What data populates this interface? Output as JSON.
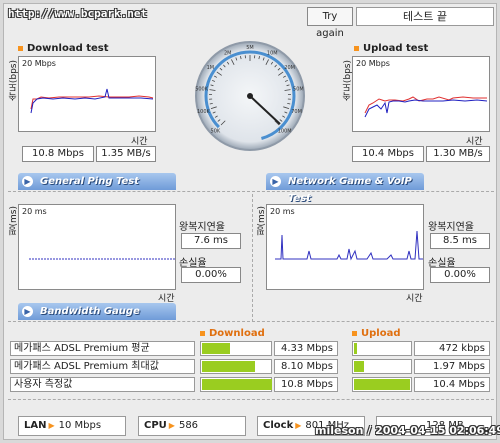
{
  "header": {
    "url": "http://www.bcpark.net",
    "try_again": "Try again",
    "test_end": "테스트 끝"
  },
  "download": {
    "title": "Download test",
    "scale": "20 Mbps",
    "ylabel": "속도(bps)",
    "xlabel": "시간",
    "mbps": "10.8 Mbps",
    "mbs": "1.35 MB/s"
  },
  "upload": {
    "title": "Upload test",
    "scale": "20 Mbps",
    "ylabel": "속도(bps)",
    "xlabel": "시간",
    "mbps": "10.4 Mbps",
    "mbs": "1.30 MB/s"
  },
  "gauge": {
    "marks": [
      "50K",
      "100K",
      "500K",
      "1M",
      "2M",
      "5M",
      "10M",
      "20M",
      "50M",
      "70M",
      "100M"
    ]
  },
  "ping": {
    "banner": "General Ping Test",
    "scale": "20 ms",
    "ylabel": "핑(ms)",
    "xlabel": "시간",
    "rtt_label": "왕복지연율",
    "rtt": "7.6 ms",
    "loss_label": "손실율",
    "loss": "0.00%"
  },
  "game": {
    "banner": "Network Game & VoIP Test",
    "scale": "20 ms",
    "ylabel": "핑(ms)",
    "xlabel": "시간",
    "rtt_label": "왕복지연율",
    "rtt": "8.5 ms",
    "loss_label": "손실율",
    "loss": "0.00%"
  },
  "bandwidth": {
    "banner": "Bandwidth Gauge",
    "download_header": "Download",
    "upload_header": "Upload",
    "rows": [
      {
        "label": "메가패스 ADSL Premium 평균",
        "down": "4.33 Mbps",
        "down_fill": 0.4,
        "up": "472 kbps",
        "up_fill": 0.05
      },
      {
        "label": "메가패스 ADSL Premium 최대값",
        "down": "8.10 Mbps",
        "down_fill": 0.75,
        "up": "1.97 Mbps",
        "up_fill": 0.18
      },
      {
        "label": "사용자 측정값",
        "down": "10.8 Mbps",
        "down_fill": 1.0,
        "up": "10.4 Mbps",
        "up_fill": 0.96
      }
    ]
  },
  "footer": {
    "lan_label": "LAN",
    "lan": "10 Mbps",
    "cpu_label": "CPU",
    "cpu": "586",
    "clock_label": "Clock",
    "clock": "801 MHz",
    "ram": "128 MB",
    "watermark": "mileson / 2004-04-15 02:06:49"
  },
  "colors": {
    "accent": "#f7931e",
    "bar": "#9acd20",
    "banner": "#6f9bd8"
  }
}
